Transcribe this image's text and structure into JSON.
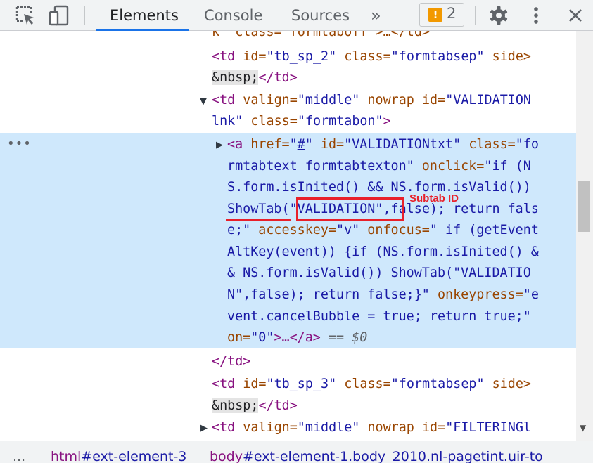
{
  "toolbar": {
    "tabs": [
      "Elements",
      "Console",
      "Sources"
    ],
    "more_tabs": "»",
    "issues_count": "2",
    "issues_icon_glyph": "!"
  },
  "code_lines": {
    "l0": "k\" class=\"formtaboff\">…</td>",
    "l1_tag1": "<td",
    "l1_an1": " id=",
    "l1_av1": "\"tb_sp_2\"",
    "l1_an2": " class=",
    "l1_av2": "\"formtabsep\"",
    "l1_an3": " side>",
    "l2_ent": "&nbsp;",
    "l2_tag": "</td>",
    "l3_tag1": "<td",
    "l3_an1": " valign=",
    "l3_av1": "\"middle\"",
    "l3_an2": " nowrap",
    "l3_an3": " id=",
    "l3_av3": "\"VALIDATION",
    "l4_av": "lnk\"",
    "l4_an": " class=",
    "l4_av2": "\"formtabon\"",
    "l4_tag": ">",
    "l5_tag": "<a",
    "l5_an1": " href=",
    "l5_q1": "\"",
    "l5_link": "#",
    "l5_q2": "\"",
    "l5_an2": " id=",
    "l5_av2": "\"VALIDATIONtxt\"",
    "l5_an3": " class=",
    "l5_av3": "\"fo",
    "l6_av": "rmtabtext formtabtexton\"",
    "l6_an": " onclick=",
    "l6_av2": "\"if (N",
    "l7": "S.form.isInited() && NS.form.isValid())",
    "l8_link": "ShowTab",
    "l8_rest": "(\"VALIDATION\",false); return fals",
    "l9_av": "e;\"",
    "l9_an": " accesskey=",
    "l9_av2": "\"v\"",
    "l9_an2": " onfocus=",
    "l9_av3": "\" if (getEvent",
    "l10": "AltKey(event)) {if (NS.form.isInited() &",
    "l11": "& NS.form.isValid()) ShowTab(\"VALIDATIO",
    "l12_av": "N\",false); return false;}\"",
    "l12_an": " onkeypress=",
    "l12_av2": "\"e",
    "l13": "vent.cancelBubble = true; return true;\"",
    "l14_an": "on=",
    "l14_av": "\"0\"",
    "l14_tag": ">…</a>",
    "l14_dim": " == $0",
    "l15_tag": "</td>",
    "l16_tag1": "<td",
    "l16_an1": " id=",
    "l16_av1": "\"tb_sp_3\"",
    "l16_an2": " class=",
    "l16_av2": "\"formtabsep\"",
    "l16_an3": " side>",
    "l17_ent": "&nbsp;",
    "l17_tag": "</td>",
    "l18_tag1": "<td",
    "l18_an1": " valign=",
    "l18_av1": "\"middle\"",
    "l18_an2": " nowrap",
    "l18_an3": " id=",
    "l18_av3": "\"FILTERINGl"
  },
  "annotation": {
    "label": "Subtab ID"
  },
  "row_menu": "•••",
  "breadcrumb": {
    "dots": "...",
    "items": [
      {
        "tag": "html",
        "id": "#ext-element-3"
      },
      {
        "tag": "body",
        "id": "#ext-element-1",
        "cls": ".body_2010.nl-pagetint.uir-to"
      }
    ]
  },
  "colors": {
    "accent": "#1a73e8",
    "selection": "#cfe8fc",
    "annotation": "#e8202a",
    "warning": "#f29900"
  }
}
